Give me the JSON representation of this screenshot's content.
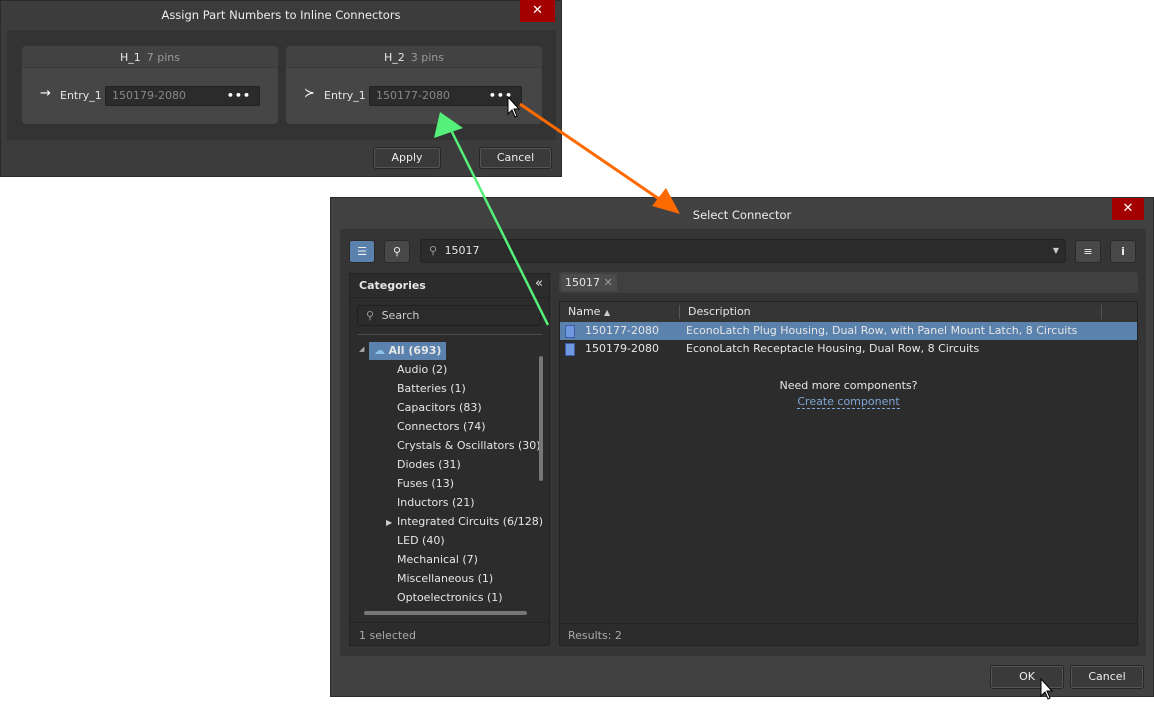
{
  "assign_dialog": {
    "title": "Assign Part Numbers to Inline Connectors",
    "close_label": "✕",
    "connectors": [
      {
        "name": "H_1",
        "pins": "7 pins",
        "entry": "Entry_1",
        "part_number": "150179-2080",
        "browse_label": "•••"
      },
      {
        "name": "H_2",
        "pins": "3 pins",
        "entry": "Entry_1",
        "part_number": "150177-2080",
        "browse_label": "•••"
      }
    ],
    "apply_label": "Apply",
    "cancel_label": "Cancel"
  },
  "select_dialog": {
    "title": "Select Connector",
    "close_label": "✕",
    "search_value": "15017",
    "categories": {
      "header": "Categories",
      "collapse_label": "«",
      "search_placeholder": "Search",
      "items": [
        {
          "label": "All (693)",
          "selected": true
        },
        {
          "label": "Audio (2)"
        },
        {
          "label": "Batteries (1)"
        },
        {
          "label": "Capacitors (83)"
        },
        {
          "label": "Connectors (74)"
        },
        {
          "label": "Crystals & Oscillators (30)"
        },
        {
          "label": "Diodes (31)"
        },
        {
          "label": "Fuses (13)"
        },
        {
          "label": "Inductors (21)"
        },
        {
          "label": "Integrated Circuits (6/128)",
          "expandable": true
        },
        {
          "label": "LED (40)"
        },
        {
          "label": "Mechanical (7)"
        },
        {
          "label": "Miscellaneous (1)"
        },
        {
          "label": "Optoelectronics (1)"
        }
      ],
      "footer": "1 selected"
    },
    "filter_chip": "15017",
    "table": {
      "columns": [
        "Name",
        "Description"
      ],
      "rows": [
        {
          "name": "150177-2080",
          "description": "EconoLatch Plug Housing, Dual Row, with Panel Mount Latch, 8 Circuits",
          "selected": true
        },
        {
          "name": "150179-2080",
          "description": "EconoLatch Receptacle Housing, Dual Row, 8 Circuits"
        }
      ],
      "empty_prompt": "Need more components?",
      "create_link": "Create component",
      "results": "Results: 2"
    },
    "ok_label": "OK",
    "cancel_label": "Cancel"
  },
  "colors": {
    "accent": "#5b82ad",
    "close": "#a50000",
    "orange_arrow": "#ff6a00",
    "green_arrow": "#55f07a"
  }
}
